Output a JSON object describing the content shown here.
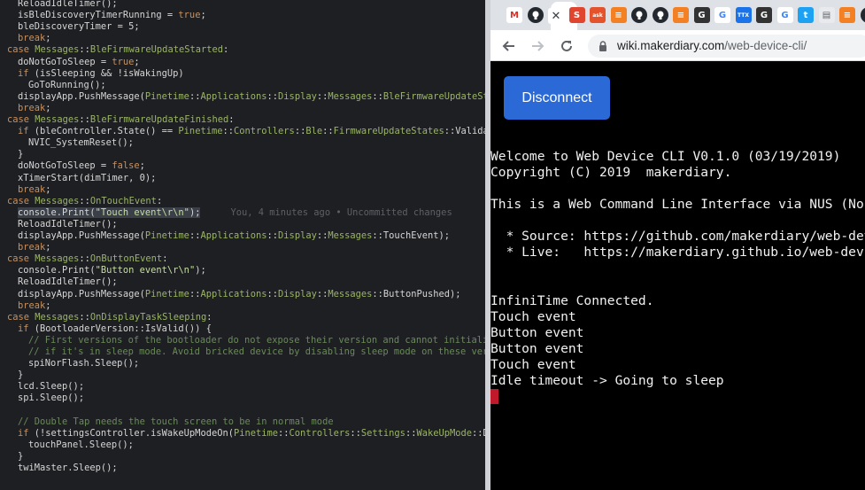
{
  "editor": {
    "blame": "You, 4 minutes ago • Uncommitted changes",
    "lines": [
      {
        "i": 0,
        "t": "ReloadIdleTimer();"
      },
      {
        "i": 0,
        "t": "isBleDiscoveryTimerRunning = true;"
      },
      {
        "i": 0,
        "t": "bleDiscoveryTimer = 5;"
      },
      {
        "i": 0,
        "t": "break;"
      },
      {
        "i": 1,
        "t": "case Messages::BleFirmwareUpdateStarted:"
      },
      {
        "i": 0,
        "t": "doNotGoToSleep = true;"
      },
      {
        "i": 0,
        "t": "if (isSleeping && !isWakingUp)"
      },
      {
        "i": 2,
        "t": "GoToRunning();"
      },
      {
        "i": 0,
        "t": "displayApp.PushMessage(Pinetime::Applications::Display::Messages::BleFirmwareUpdateStarted);"
      },
      {
        "i": 0,
        "t": "break;"
      },
      {
        "i": 1,
        "t": "case Messages::BleFirmwareUpdateFinished:"
      },
      {
        "i": 0,
        "t": "if (bleController.State() == Pinetime::Controllers::Ble::FirmwareUpdateStates::Validated) {"
      },
      {
        "i": 2,
        "t": "NVIC_SystemReset();"
      },
      {
        "i": 0,
        "t": "}"
      },
      {
        "i": 0,
        "t": "doNotGoToSleep = false;"
      },
      {
        "i": 0,
        "t": "xTimerStart(dimTimer, 0);"
      },
      {
        "i": 0,
        "t": "break;"
      },
      {
        "i": 1,
        "t": "case Messages::OnTouchEvent:"
      },
      {
        "i": 0,
        "t": "console.Print(\"Touch event\\r\\n\");"
      },
      {
        "i": 0,
        "t": "ReloadIdleTimer();"
      },
      {
        "i": 0,
        "t": "displayApp.PushMessage(Pinetime::Applications::Display::Messages::TouchEvent);"
      },
      {
        "i": 0,
        "t": "break;"
      },
      {
        "i": 1,
        "t": "case Messages::OnButtonEvent:"
      },
      {
        "i": 0,
        "t": "console.Print(\"Button event\\r\\n\");"
      },
      {
        "i": 0,
        "t": "ReloadIdleTimer();"
      },
      {
        "i": 0,
        "t": "displayApp.PushMessage(Pinetime::Applications::Display::Messages::ButtonPushed);"
      },
      {
        "i": 0,
        "t": "break;"
      },
      {
        "i": 1,
        "t": "case Messages::OnDisplayTaskSleeping:"
      },
      {
        "i": 0,
        "t": "if (BootloaderVersion::IsValid()) {"
      },
      {
        "i": 2,
        "t": "// First versions of the bootloader do not expose their version and cannot initialize the SPI NOR FLASH"
      },
      {
        "i": 2,
        "t": "// if it's in sleep mode. Avoid bricked device by disabling sleep mode on these versions."
      },
      {
        "i": 2,
        "t": "spiNorFlash.Sleep();"
      },
      {
        "i": 0,
        "t": "}"
      },
      {
        "i": 0,
        "t": "lcd.Sleep();"
      },
      {
        "i": 0,
        "t": "spi.Sleep();"
      },
      {
        "i": 0,
        "t": ""
      },
      {
        "i": 0,
        "t": "// Double Tap needs the touch screen to be in normal mode"
      },
      {
        "i": 0,
        "t": "if (!settingsController.isWakeUpModeOn(Pinetime::Controllers::Settings::WakeUpMode::DoubleTap)) {"
      },
      {
        "i": 2,
        "t": "touchPanel.Sleep();"
      },
      {
        "i": 0,
        "t": "}"
      },
      {
        "i": 0,
        "t": "twiMaster.Sleep();"
      }
    ]
  },
  "browser": {
    "tabs": [
      {
        "icon": "gmail-icon",
        "color": "#ffffff",
        "glyph": "M",
        "fg": "#d93025"
      },
      {
        "icon": "github-icon",
        "color": "#24292f",
        "glyph": "",
        "fg": "#ffffff"
      },
      {
        "icon": "close-icon",
        "color": "#ffffff",
        "glyph": "✕",
        "fg": "#3c4043"
      },
      {
        "icon": "scribd-icon",
        "color": "#e0462f",
        "glyph": "S",
        "fg": "#ffffff"
      },
      {
        "icon": "askubuntu-icon",
        "color": "#e5532d",
        "glyph": "ask",
        "fg": "#ffffff"
      },
      {
        "icon": "stackoverflow-icon",
        "color": "#f48024",
        "glyph": "≡",
        "fg": "#ffffff"
      },
      {
        "icon": "github-icon",
        "color": "#24292f",
        "glyph": "",
        "fg": "#ffffff"
      },
      {
        "icon": "github-icon",
        "color": "#24292f",
        "glyph": "",
        "fg": "#ffffff"
      },
      {
        "icon": "stackoverflow-icon",
        "color": "#f48024",
        "glyph": "≡",
        "fg": "#ffffff"
      },
      {
        "icon": "extension-icon",
        "color": "#333333",
        "glyph": "G",
        "fg": "#ffffff"
      },
      {
        "icon": "google-icon",
        "color": "#ffffff",
        "glyph": "G",
        "fg": "#4285f4"
      },
      {
        "icon": "ttx-icon",
        "color": "#1a73e8",
        "glyph": "TTX",
        "fg": "#ffffff"
      },
      {
        "icon": "extension-icon",
        "color": "#333333",
        "glyph": "G",
        "fg": "#ffffff"
      },
      {
        "icon": "google-icon",
        "color": "#ffffff",
        "glyph": "G",
        "fg": "#4285f4"
      },
      {
        "icon": "twitter-icon",
        "color": "#1da1f2",
        "glyph": "t",
        "fg": "#ffffff"
      },
      {
        "icon": "site-icon",
        "color": "#e8eaed",
        "glyph": "▤",
        "fg": "#5f6368"
      },
      {
        "icon": "stackoverflow-icon",
        "color": "#f48024",
        "glyph": "≡",
        "fg": "#ffffff"
      },
      {
        "icon": "github-icon",
        "color": "#24292f",
        "glyph": "",
        "fg": "#ffffff"
      }
    ],
    "url_host": "wiki.makerdiary.com",
    "url_path": "/web-device-cli/",
    "disconnect_label": "Disconnect",
    "terminal": [
      "Welcome to Web Device CLI V0.1.0 (03/19/2019)",
      "Copyright (C) 2019  makerdiary.",
      "",
      "This is a Web Command Line Interface via NUS (Nordic UART Service) using Web Bluetooth.",
      "",
      "  * Source: https://github.com/makerdiary/web-device-cli",
      "  * Live:   https://makerdiary.github.io/web-device-cli",
      "",
      "",
      "InfiniTime Connected.",
      "Touch event",
      "Button event",
      "Button event",
      "Touch event",
      "Idle timeout -> Going to sleep"
    ]
  }
}
